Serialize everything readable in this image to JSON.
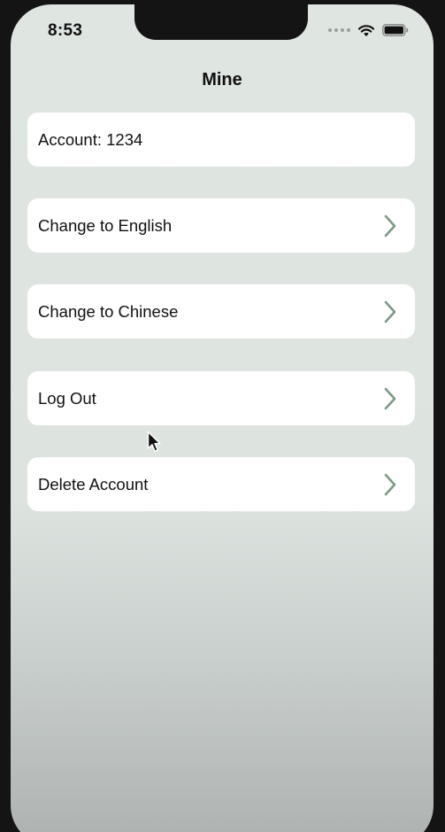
{
  "status_bar": {
    "time": "8:53",
    "icons": [
      "signal-dots-icon",
      "wifi-icon",
      "battery-icon"
    ]
  },
  "nav": {
    "title": "Mine"
  },
  "account": {
    "label": "Account: 1234"
  },
  "menu": {
    "items": [
      {
        "label": "Change to English",
        "icon": "chevron-right-icon"
      },
      {
        "label": "Change to Chinese",
        "icon": "chevron-right-icon"
      },
      {
        "label": "Log Out",
        "icon": "chevron-right-icon"
      },
      {
        "label": "Delete Account",
        "icon": "chevron-right-icon"
      }
    ]
  },
  "colors": {
    "background_top": "#dfe6e2",
    "background_bottom": "#aeb3b1",
    "card": "#ffffff",
    "chevron": "#7a9a86",
    "text": "#111111"
  }
}
